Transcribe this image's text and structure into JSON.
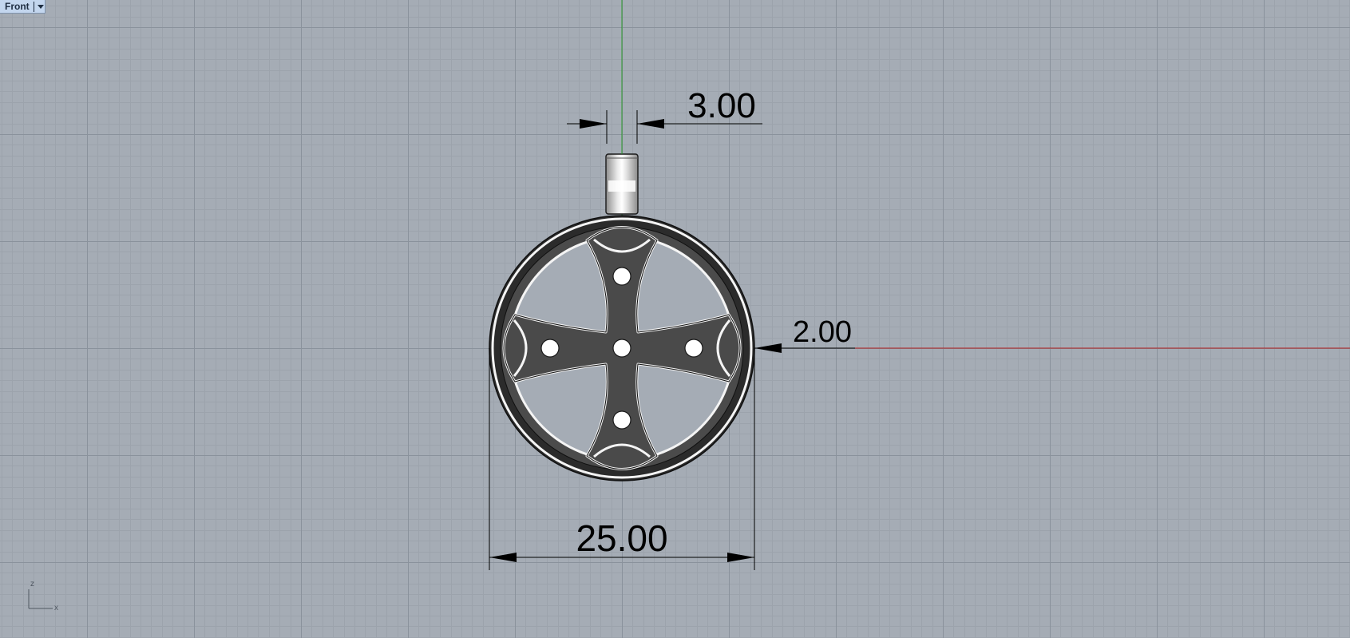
{
  "viewport": {
    "name": "Front",
    "background": "#a5acb5",
    "grid_minor_color": "#9ca3ac",
    "grid_major_color": "#8a929c",
    "x_axis_color": "#b22222",
    "z_axis_color": "#2a9a2a"
  },
  "dimensions": {
    "loop_width": "3.00",
    "ring_width": "2.00",
    "diameter": "25.00"
  },
  "axis_widget": {
    "vertical_label": "z",
    "horizontal_label": "x"
  },
  "icons": {
    "viewport_menu": "chevron-down-icon"
  }
}
